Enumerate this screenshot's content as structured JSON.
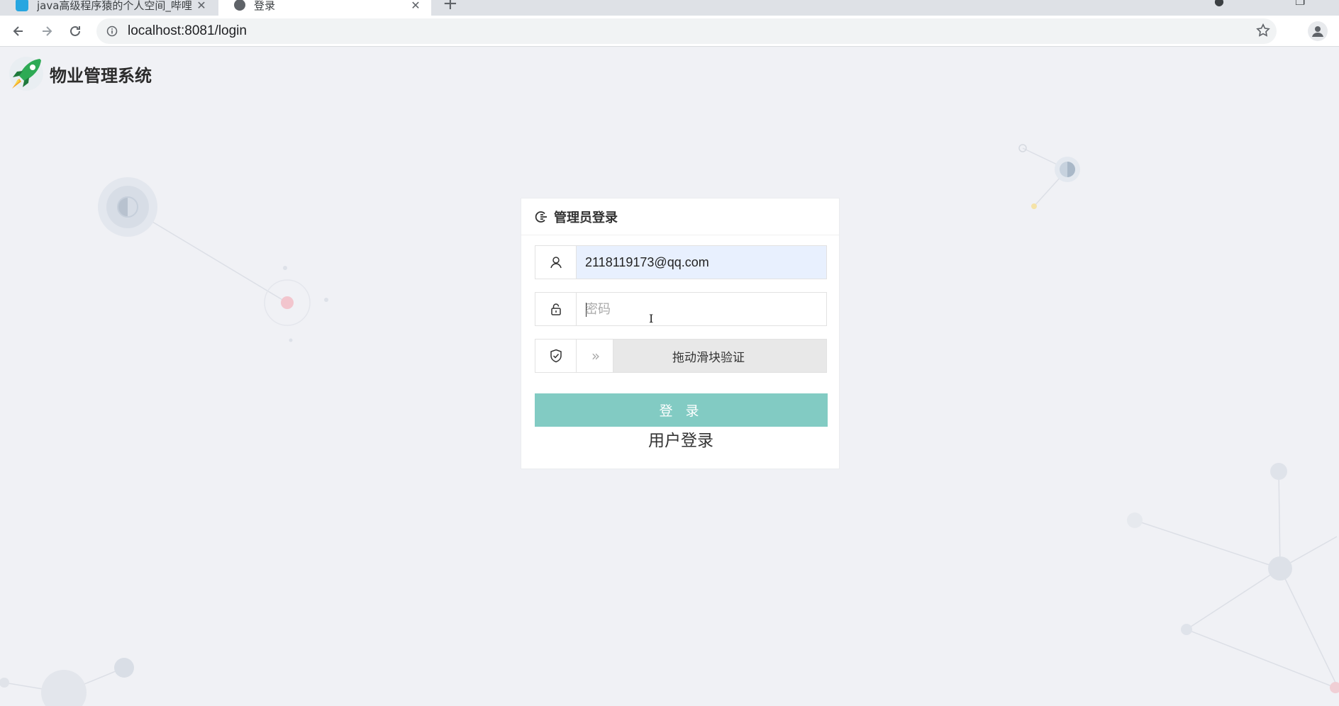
{
  "browser": {
    "tabs": [
      {
        "label": "java高级程序猿的个人空间_哔哩",
        "active": false
      },
      {
        "label": "登录",
        "active": true
      }
    ],
    "url": "localhost:8081/login"
  },
  "brand": {
    "name": "物业管理系统"
  },
  "login": {
    "title": "管理员登录",
    "username_value": "2118119173@qq.com",
    "password_placeholder": "密码",
    "slider_text": "拖动滑块验证",
    "slider_handle": "»",
    "login_button": "登 录",
    "user_login_link": "用户登录"
  },
  "colors": {
    "login_button": "#82cbc3",
    "autofill": "#e8f0fe",
    "page_background": "#f0f1f5"
  }
}
